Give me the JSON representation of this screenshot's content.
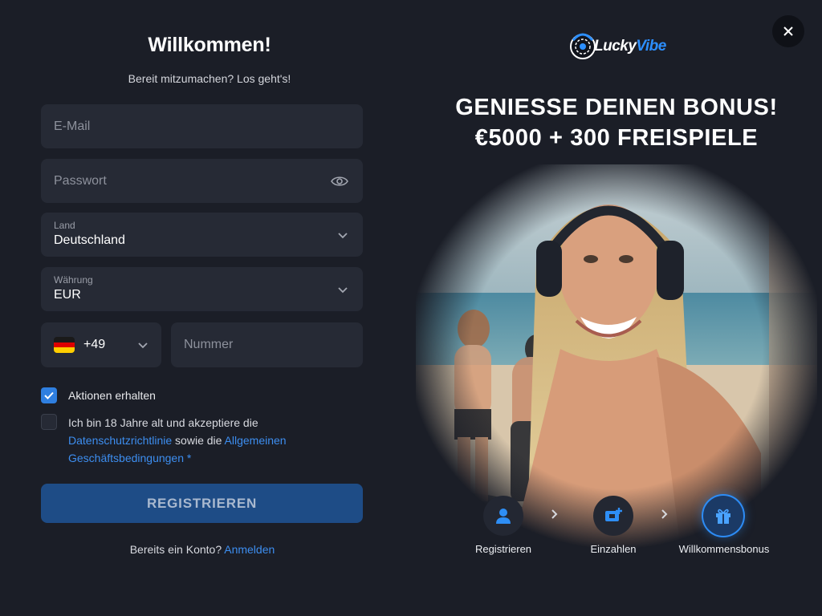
{
  "form": {
    "title": "Willkommen!",
    "subtitle": "Bereit mitzumachen? Los geht's!",
    "email_placeholder": "E-Mail",
    "password_placeholder": "Passwort",
    "country": {
      "label": "Land",
      "value": "Deutschland"
    },
    "currency": {
      "label": "Währung",
      "value": "EUR"
    },
    "phone": {
      "country_code": "+49",
      "flag": "germany-flag",
      "number_placeholder": "Nummer"
    },
    "promotions": {
      "label": "Aktionen erhalten",
      "checked": true
    },
    "terms": {
      "checked": false,
      "text_before": "Ich bin 18 Jahre alt und akzeptiere die",
      "privacy_link": "Datenschutzrichtlinie",
      "text_middle": " sowie die ",
      "agb_link": "Allgemeinen Geschäftsbedingungen *"
    },
    "register_button": "REGISTRIEREN",
    "login_prompt": "Bereits ein Konto?",
    "login_link": "Anmelden"
  },
  "promo": {
    "logo_text_1": "Lucky",
    "logo_text_2": "Vibe",
    "headline_line1": "GENIESSE DEINEN BONUS!",
    "headline_line2": "€5000 + 300 FREISPIELE",
    "steps": [
      {
        "label": "Registrieren",
        "icon": "user-icon"
      },
      {
        "label": "Einzahlen",
        "icon": "deposit-card-icon"
      },
      {
        "label": "Willkommensbonus",
        "icon": "gift-icon"
      }
    ]
  },
  "colors": {
    "background": "#1b1e27",
    "field": "#262a35",
    "accent": "#2f7fe0",
    "link": "#3d8ef0",
    "button": "#1e4c86"
  }
}
